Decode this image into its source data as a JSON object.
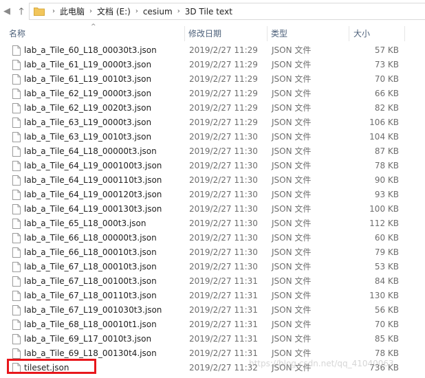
{
  "breadcrumbs": [
    "此电脑",
    "文档 (E:)",
    "cesium",
    "3D Tile text"
  ],
  "columns": {
    "name": "名称",
    "date": "修改日期",
    "type": "类型",
    "size": "大小"
  },
  "files": [
    {
      "name": "lab_a_Tile_60_L18_00030t3.json",
      "date": "2019/2/27 11:29",
      "type": "JSON 文件",
      "size": "57 KB"
    },
    {
      "name": "lab_a_Tile_61_L19_0000t3.json",
      "date": "2019/2/27 11:29",
      "type": "JSON 文件",
      "size": "73 KB"
    },
    {
      "name": "lab_a_Tile_61_L19_0010t3.json",
      "date": "2019/2/27 11:29",
      "type": "JSON 文件",
      "size": "70 KB"
    },
    {
      "name": "lab_a_Tile_62_L19_0000t3.json",
      "date": "2019/2/27 11:29",
      "type": "JSON 文件",
      "size": "66 KB"
    },
    {
      "name": "lab_a_Tile_62_L19_0020t3.json",
      "date": "2019/2/27 11:29",
      "type": "JSON 文件",
      "size": "82 KB"
    },
    {
      "name": "lab_a_Tile_63_L19_0000t3.json",
      "date": "2019/2/27 11:29",
      "type": "JSON 文件",
      "size": "106 KB"
    },
    {
      "name": "lab_a_Tile_63_L19_0010t3.json",
      "date": "2019/2/27 11:30",
      "type": "JSON 文件",
      "size": "104 KB"
    },
    {
      "name": "lab_a_Tile_64_L18_00000t3.json",
      "date": "2019/2/27 11:30",
      "type": "JSON 文件",
      "size": "87 KB"
    },
    {
      "name": "lab_a_Tile_64_L19_000100t3.json",
      "date": "2019/2/27 11:30",
      "type": "JSON 文件",
      "size": "78 KB"
    },
    {
      "name": "lab_a_Tile_64_L19_000110t3.json",
      "date": "2019/2/27 11:30",
      "type": "JSON 文件",
      "size": "90 KB"
    },
    {
      "name": "lab_a_Tile_64_L19_000120t3.json",
      "date": "2019/2/27 11:30",
      "type": "JSON 文件",
      "size": "93 KB"
    },
    {
      "name": "lab_a_Tile_64_L19_000130t3.json",
      "date": "2019/2/27 11:30",
      "type": "JSON 文件",
      "size": "100 KB"
    },
    {
      "name": "lab_a_Tile_65_L18_000t3.json",
      "date": "2019/2/27 11:30",
      "type": "JSON 文件",
      "size": "112 KB"
    },
    {
      "name": "lab_a_Tile_66_L18_00000t3.json",
      "date": "2019/2/27 11:30",
      "type": "JSON 文件",
      "size": "60 KB"
    },
    {
      "name": "lab_a_Tile_66_L18_00010t3.json",
      "date": "2019/2/27 11:30",
      "type": "JSON 文件",
      "size": "79 KB"
    },
    {
      "name": "lab_a_Tile_67_L18_00010t3.json",
      "date": "2019/2/27 11:30",
      "type": "JSON 文件",
      "size": "53 KB"
    },
    {
      "name": "lab_a_Tile_67_L18_00100t3.json",
      "date": "2019/2/27 11:31",
      "type": "JSON 文件",
      "size": "84 KB"
    },
    {
      "name": "lab_a_Tile_67_L18_00110t3.json",
      "date": "2019/2/27 11:31",
      "type": "JSON 文件",
      "size": "130 KB"
    },
    {
      "name": "lab_a_Tile_67_L19_001030t3.json",
      "date": "2019/2/27 11:31",
      "type": "JSON 文件",
      "size": "56 KB"
    },
    {
      "name": "lab_a_Tile_68_L18_00010t1.json",
      "date": "2019/2/27 11:31",
      "type": "JSON 文件",
      "size": "70 KB"
    },
    {
      "name": "lab_a_Tile_69_L17_0010t3.json",
      "date": "2019/2/27 11:31",
      "type": "JSON 文件",
      "size": "85 KB"
    },
    {
      "name": "lab_a_Tile_69_L18_00130t4.json",
      "date": "2019/2/27 11:31",
      "type": "JSON 文件",
      "size": "78 KB"
    },
    {
      "name": "tileset.json",
      "date": "2019/2/27 11:32",
      "type": "JSON 文件",
      "size": "736 KB"
    }
  ],
  "watermark": "https://blog.csdn.net/qq_41040063",
  "icons": {
    "back": "arrow-left-icon",
    "up": "arrow-up-icon",
    "folder": "folder-icon",
    "file": "file-icon",
    "sort": "sort-asc-icon"
  },
  "colors": {
    "highlight": "#e8161b",
    "header_text": "#4c607a",
    "folder": "#f2c65c"
  }
}
